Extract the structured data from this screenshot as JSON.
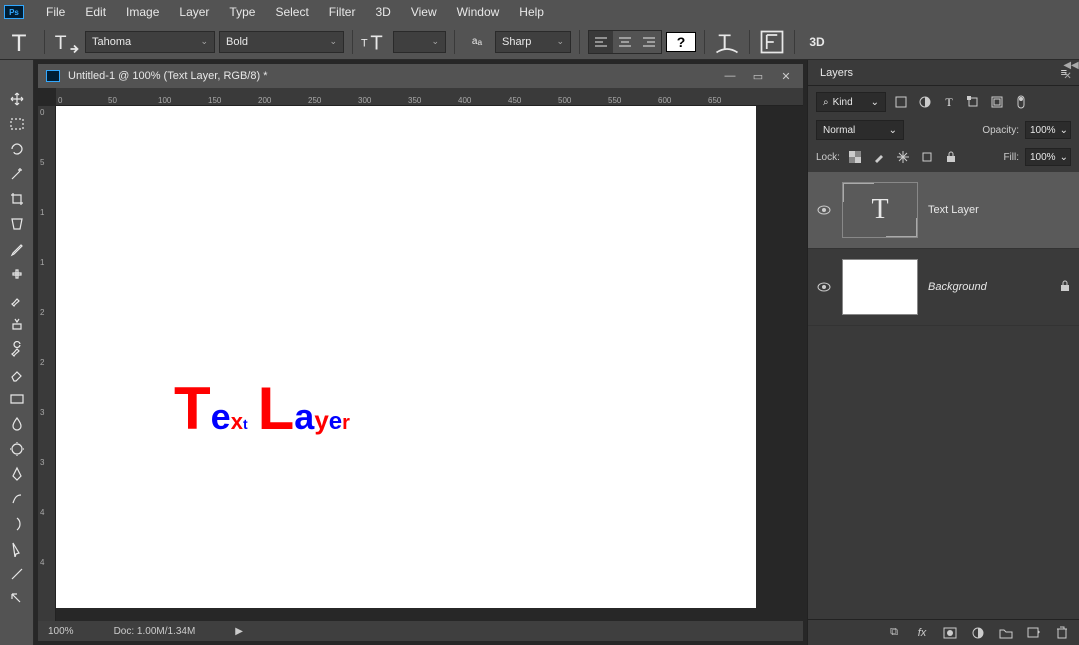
{
  "menu": [
    "File",
    "Edit",
    "Image",
    "Layer",
    "Type",
    "Select",
    "Filter",
    "3D",
    "View",
    "Window",
    "Help"
  ],
  "options": {
    "font": "Tahoma",
    "weight": "Bold",
    "aa_label": "Sharp",
    "threeD": "3D"
  },
  "doc": {
    "title": "Untitled-1 @ 100% (Text  Layer, RGB/8) *",
    "zoom": "100%",
    "docstat": "Doc: 1.00M/1.34M"
  },
  "ruler_h": [
    "0",
    "50",
    "100",
    "150",
    "200",
    "250",
    "300",
    "350",
    "400",
    "450",
    "500",
    "550",
    "600",
    "650"
  ],
  "ruler_v": [
    "0",
    "5",
    "1",
    "1",
    "2",
    "2",
    "3",
    "3",
    "4",
    "4"
  ],
  "layers_panel": {
    "title": "Layers",
    "kind": "Kind",
    "blend": "Normal",
    "opacity_label": "Opacity:",
    "opacity_val": "100%",
    "lock_label": "Lock:",
    "fill_label": "Fill:",
    "fill_val": "100%",
    "items": [
      {
        "name": "Text  Layer",
        "type": "text",
        "selected": true
      },
      {
        "name": "Background",
        "type": "raster",
        "locked": true
      }
    ]
  },
  "canvas_text": {
    "chars": [
      {
        "c": "T",
        "color": "red",
        "size": 60
      },
      {
        "c": "e",
        "color": "blue",
        "size": 36
      },
      {
        "c": "x",
        "color": "red",
        "size": 22
      },
      {
        "c": "t",
        "color": "blue",
        "size": 14
      },
      {
        "c": " ",
        "color": "red",
        "size": 36
      },
      {
        "c": "L",
        "color": "red",
        "size": 60
      },
      {
        "c": "a",
        "color": "blue",
        "size": 36
      },
      {
        "c": "y",
        "color": "red",
        "size": 26
      },
      {
        "c": "e",
        "color": "blue",
        "size": 24
      },
      {
        "c": "r",
        "color": "red",
        "size": 20
      }
    ]
  },
  "search_prefix": "⌕"
}
